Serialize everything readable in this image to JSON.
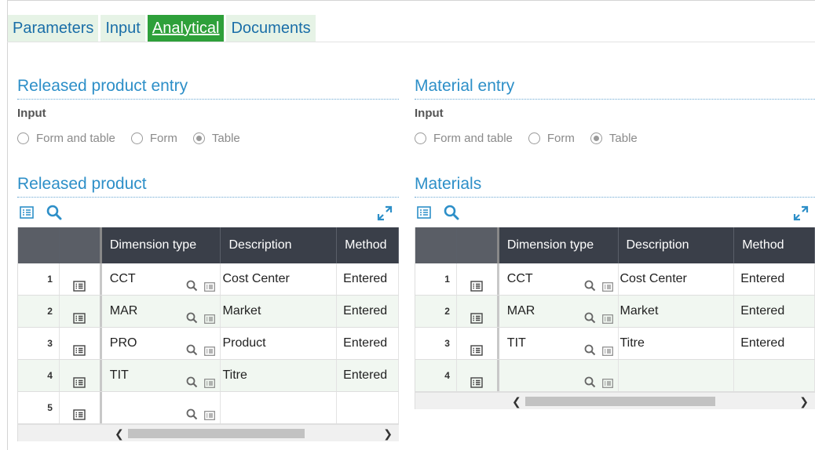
{
  "tabs": [
    {
      "label": "Parameters",
      "active": false
    },
    {
      "label": "Input",
      "active": false
    },
    {
      "label": "Analytical",
      "active": true
    },
    {
      "label": "Documents",
      "active": false
    }
  ],
  "colors": {
    "accent": "#2ea03a",
    "title_blue": "#2d8fc8",
    "header_bg": "#3a3f49",
    "tab_bg": "#e6f3e6"
  },
  "left": {
    "entry_title": "Released product entry",
    "input_label": "Input",
    "radio_options": [
      "Form and table",
      "Form",
      "Table"
    ],
    "selected": "Table",
    "table_title": "Released product",
    "columns": [
      "",
      "",
      "Dimension type",
      "Description",
      "Method"
    ],
    "rows": [
      {
        "num": "1",
        "dim": "CCT",
        "desc": "Cost Center",
        "method": "Entered"
      },
      {
        "num": "2",
        "dim": "MAR",
        "desc": "Market",
        "method": "Entered"
      },
      {
        "num": "3",
        "dim": "PRO",
        "desc": "Product",
        "method": "Entered"
      },
      {
        "num": "4",
        "dim": "TIT",
        "desc": "Titre",
        "method": "Entered"
      },
      {
        "num": "5",
        "dim": "",
        "desc": "",
        "method": ""
      }
    ]
  },
  "right": {
    "entry_title": "Material entry",
    "input_label": "Input",
    "radio_options": [
      "Form and table",
      "Form",
      "Table"
    ],
    "selected": "Table",
    "table_title": "Materials",
    "columns": [
      "",
      "",
      "Dimension type",
      "Description",
      "Method"
    ],
    "rows": [
      {
        "num": "1",
        "dim": "CCT",
        "desc": "Cost Center",
        "method": "Entered"
      },
      {
        "num": "2",
        "dim": "MAR",
        "desc": "Market",
        "method": "Entered"
      },
      {
        "num": "3",
        "dim": "TIT",
        "desc": "Titre",
        "method": "Entered"
      },
      {
        "num": "4",
        "dim": "",
        "desc": "",
        "method": ""
      }
    ]
  },
  "icons": {
    "list": "list-icon",
    "search": "search-icon",
    "expand": "expand-icon",
    "scroll_left": "chevron-left-icon",
    "scroll_right": "chevron-right-icon"
  }
}
